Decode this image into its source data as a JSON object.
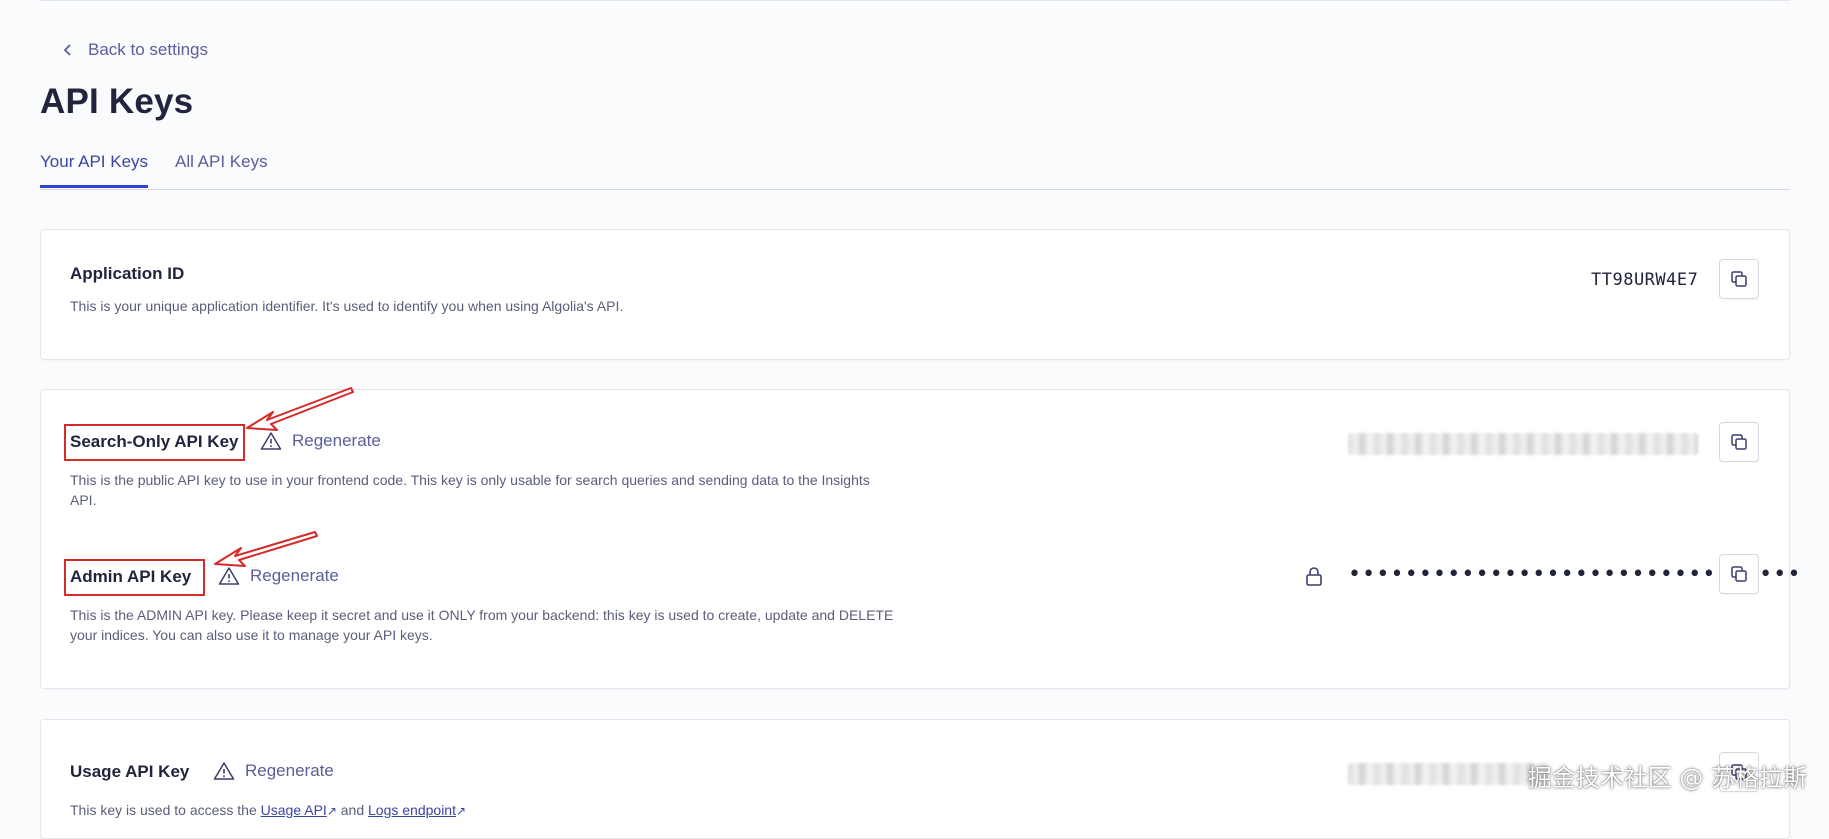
{
  "nav": {
    "back_label": "Back to settings"
  },
  "page": {
    "title": "API Keys"
  },
  "tabs": [
    {
      "label": "Your API Keys",
      "active": true
    },
    {
      "label": "All API Keys",
      "active": false
    }
  ],
  "application_id": {
    "label": "Application ID",
    "description": "This is your unique application identifier. It's used to identify you when using Algolia's API.",
    "value": "TT98URW4E7"
  },
  "search_only_key": {
    "label": "Search-Only API Key",
    "regenerate_label": "Regenerate",
    "description": "This is the public API key to use in your frontend code. This key is only usable for search queries and sending data to the Insights API."
  },
  "admin_key": {
    "label": "Admin API Key",
    "regenerate_label": "Regenerate",
    "description": "This is the ADMIN API key. Please keep it secret and use it ONLY from your backend: this key is used to create, update and DELETE your indices. You can also use it to manage your API keys.",
    "masked_value": "••••••••••••••••••••••••••••••••"
  },
  "usage_key": {
    "label": "Usage API Key",
    "regenerate_label": "Regenerate",
    "description_prefix": "This key is used to access the",
    "link1": "Usage API",
    "middle": "and",
    "link2": "Logs endpoint"
  },
  "watermark": "掘金技术社区 @ 苏格拉斯",
  "colors": {
    "accent": "#2e45d6",
    "link": "#3a46a3",
    "annotation_red": "#d42a2a",
    "text_primary": "#21243d",
    "text_secondary": "#5a5e9a"
  },
  "icons": {
    "back": "chevron-left-icon",
    "copy": "copy-icon",
    "warning": "warning-triangle-icon",
    "lock": "lock-icon",
    "external": "external-link-icon"
  }
}
